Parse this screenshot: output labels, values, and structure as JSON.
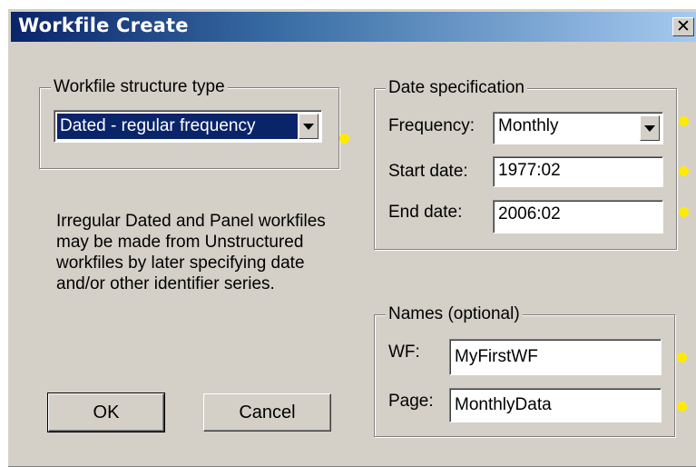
{
  "dialog": {
    "title": "Workfile Create",
    "close_glyph": "✕"
  },
  "structure": {
    "legend": "Workfile structure type",
    "selected": "Dated - regular frequency"
  },
  "info_text": "Irregular Dated and Panel workfiles may be made from Unstructured workfiles by later specifying date and/or other identifier series.",
  "date_spec": {
    "legend": "Date specification",
    "frequency_label": "Frequency:",
    "frequency_value": "Monthly",
    "start_label": "Start date:",
    "start_value": "1977:02",
    "end_label": "End date:",
    "end_value": "2006:02"
  },
  "names": {
    "legend": "Names (optional)",
    "wf_label": "WF:",
    "wf_value": "MyFirstWF",
    "page_label": "Page:",
    "page_value": "MonthlyData"
  },
  "buttons": {
    "ok": "OK",
    "cancel": "Cancel"
  },
  "colors": {
    "title_gradient_start": "#0a246a",
    "title_gradient_end": "#a6caf0",
    "dialog_face": "#d4d0c8",
    "marker_dot": "#ffeb00"
  },
  "icons": {
    "close": "close-icon",
    "dropdown": "chevron-down-icon",
    "marker": "yellow-dot-marker"
  }
}
